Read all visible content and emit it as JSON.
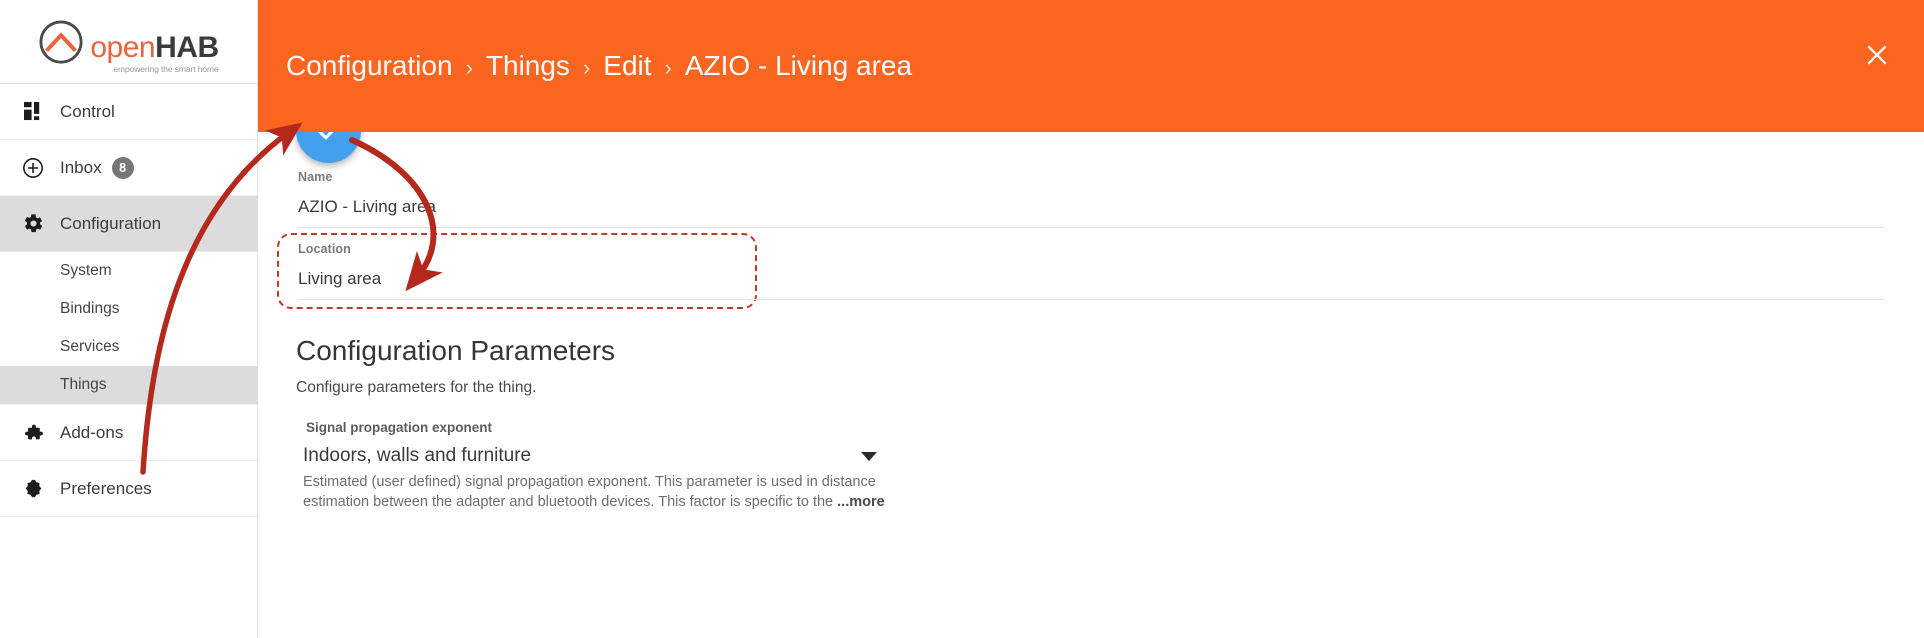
{
  "brand": {
    "logo_open": "open",
    "logo_hab": "HAB",
    "tagline": "empowering the smart home",
    "accent_orange": "#fa6620",
    "logo_orange": "#e9643c"
  },
  "sidebar": {
    "items": [
      {
        "id": "control",
        "label": "Control",
        "icon": "dashboard-grid-icon",
        "active": false
      },
      {
        "id": "inbox",
        "label": "Inbox",
        "icon": "plus-circle-icon",
        "badge": "8",
        "active": false
      },
      {
        "id": "configuration",
        "label": "Configuration",
        "icon": "gear-icon",
        "active": true
      }
    ],
    "sub_items": [
      {
        "id": "system",
        "label": "System",
        "active": false
      },
      {
        "id": "bindings",
        "label": "Bindings",
        "active": false
      },
      {
        "id": "services",
        "label": "Services",
        "active": false
      },
      {
        "id": "things",
        "label": "Things",
        "active": true
      }
    ],
    "items_bottom": [
      {
        "id": "addons",
        "label": "Add-ons",
        "icon": "puzzle-piece-icon",
        "active": false
      },
      {
        "id": "preferences",
        "label": "Preferences",
        "icon": "brightness-icon",
        "active": false
      }
    ]
  },
  "header": {
    "breadcrumb": [
      {
        "label": "Configuration"
      },
      {
        "label": "Things"
      },
      {
        "label": "Edit"
      },
      {
        "label": "AZIO - Living area"
      }
    ],
    "separator": "›",
    "close_icon": "close-icon"
  },
  "main": {
    "save_fab": {
      "icon": "check-icon",
      "color": "#42a0ee"
    },
    "name_field": {
      "label": "Name",
      "value": "AZIO - Living area"
    },
    "location_field": {
      "label": "Location",
      "value": "Living area",
      "highlighted": true
    },
    "section": {
      "title": "Configuration Parameters",
      "subtitle": "Configure parameters for the thing."
    },
    "parameter": {
      "label": "Signal propagation exponent",
      "selected_value": "Indoors, walls and furniture",
      "caret_icon": "chevron-down-icon",
      "description": "Estimated (user defined) signal propagation exponent. This parameter is used in distance estimation between the adapter and bluetooth devices. This factor is specific to the",
      "more_label": "...more"
    }
  },
  "annotations": {
    "highlight_color": "#c13a28",
    "arrows": [
      {
        "id": "arrow-things-to-save",
        "from": "sidebar-item-things",
        "to": "save-fab"
      },
      {
        "id": "arrow-save-to-location",
        "from": "save-fab",
        "to": "location-field"
      }
    ]
  }
}
